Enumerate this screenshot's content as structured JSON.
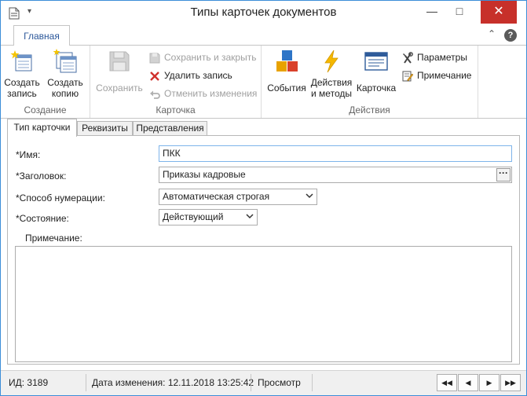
{
  "window": {
    "title": "Типы карточек документов"
  },
  "ribbon": {
    "tab_home": "Главная",
    "groups": {
      "create": {
        "caption": "Создание",
        "create_record_line1": "Создать",
        "create_record_line2": "запись",
        "create_copy_line1": "Создать",
        "create_copy_line2": "копию"
      },
      "card": {
        "caption": "Карточка",
        "save": "Сохранить",
        "save_and_close": "Сохранить и закрыть",
        "delete_record": "Удалить запись",
        "cancel_changes": "Отменить изменения"
      },
      "actions": {
        "caption": "Действия",
        "events": "События",
        "actions_methods_line1": "Действия",
        "actions_methods_line2": "и методы",
        "card": "Карточка",
        "parameters": "Параметры",
        "note": "Примечание"
      }
    }
  },
  "doc_tabs": [
    "Тип карточки",
    "Реквизиты",
    "Представления"
  ],
  "form": {
    "name_label": "*Имя:",
    "name_value": "ПКК",
    "header_label": "*Заголовок:",
    "header_value": "Приказы кадровые",
    "numbering_label": "*Способ нумерации:",
    "numbering_value": "Автоматическая строгая",
    "state_label": "*Состояние:",
    "state_value": "Действующий",
    "note_label": "Примечание:",
    "note_value": ""
  },
  "status": {
    "id": "ИД: 3189",
    "modified": "Дата изменения: 12.11.2018 13:25:42",
    "mode": "Просмотр"
  },
  "colors": {
    "accent": "#2b579a",
    "close_button": "#c7302a",
    "window_border": "#3c8ed8"
  }
}
